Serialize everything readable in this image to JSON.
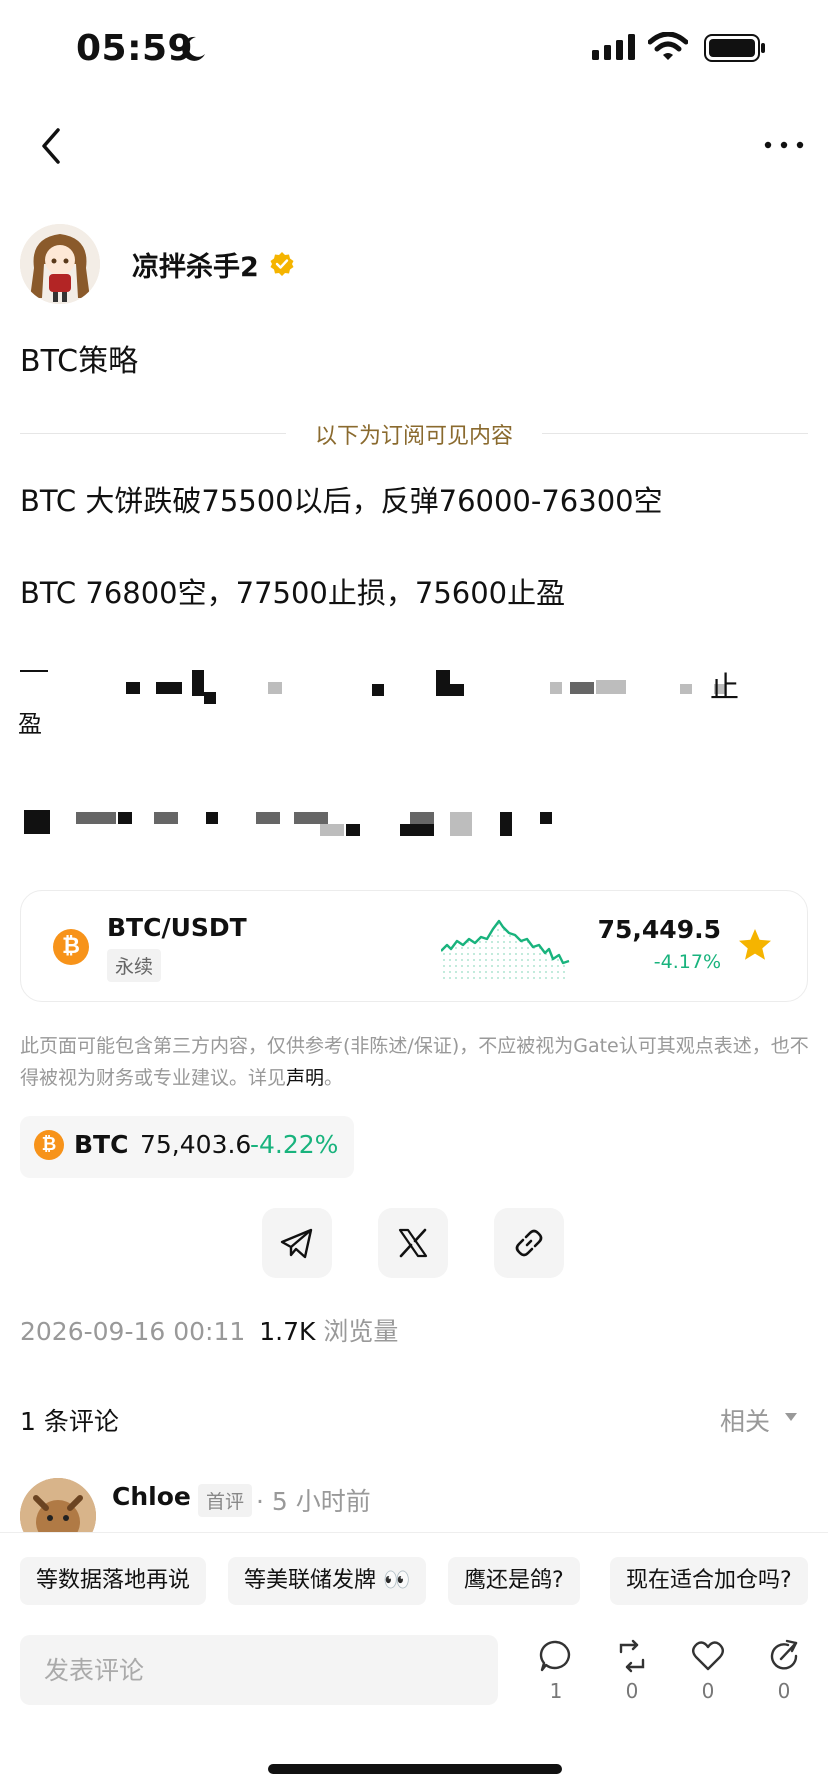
{
  "status_bar": {
    "time": "05:59"
  },
  "author": {
    "name": "凉拌杀手2"
  },
  "post": {
    "title": "BTC策略",
    "subscriber_divider": "以下为订阅可见内容",
    "lines": [
      "BTC  大饼跌破75500以后，反弹76000-76300空",
      "BTC 76800空，77500止损，75600止盈"
    ],
    "blurred_tail_1": "止",
    "blurred_tail_2": "盈"
  },
  "ticker_card": {
    "pair": "BTC/USDT",
    "tag": "永续",
    "price": "75,449.5",
    "change": "-4.17%",
    "coin_glyph": "₿",
    "accent_color": "#19b37d"
  },
  "disclaimer": {
    "text": "此页面可能包含第三方内容，仅供参考(非陈述/保证)，不应被视为Gate认可其观点表述，也不得被视为财务或专业建议。详见",
    "link": "声明",
    "end": "。"
  },
  "coin_chip": {
    "symbol": "BTC",
    "price": "75,403.6",
    "change": "-4.22%"
  },
  "share": {
    "icons": [
      "telegram-icon",
      "x-icon",
      "link-icon"
    ]
  },
  "meta": {
    "date": "2026-09-16 00:11",
    "views": "1.7K",
    "views_label": "浏览量"
  },
  "comments": {
    "count_label": "1 条评论",
    "sort_label": "相关",
    "first": {
      "name": "Chloe",
      "tag": "首评",
      "time": "· 5 小时前"
    }
  },
  "quick_replies": [
    "等数据落地再说",
    "等美联储发牌 👀",
    "鹰还是鸽?",
    "现在适合加仓吗?"
  ],
  "composer": {
    "placeholder": "发表评论"
  },
  "actions": [
    {
      "icon": "comment-icon",
      "count": "1"
    },
    {
      "icon": "repost-icon",
      "count": "0"
    },
    {
      "icon": "like-icon",
      "count": "0"
    },
    {
      "icon": "share-icon",
      "count": "0"
    }
  ]
}
